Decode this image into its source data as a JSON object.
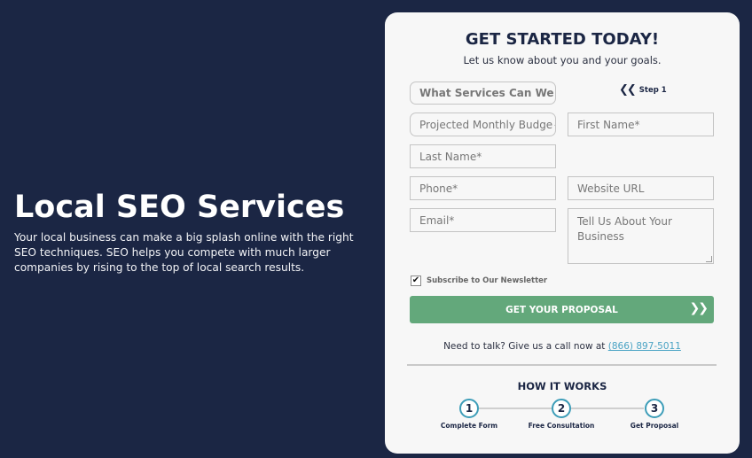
{
  "hero": {
    "title": "Local SEO Services",
    "description": "Your local business can make a big splash online with the right SEO techniques. SEO helps you compete with much larger companies by rising to the top of local search results."
  },
  "form": {
    "title": "GET STARTED TODAY!",
    "subtitle": "Let us know about you and your goals.",
    "step_label": "Step 1",
    "services_select": "What Services Can We",
    "budget_select": "Projected Monthly Budge",
    "first_name_placeholder": "First Name*",
    "last_name_placeholder": "Last Name*",
    "phone_placeholder": "Phone*",
    "website_placeholder": "Website URL",
    "email_placeholder": "Email*",
    "message_placeholder": "Tell Us About Your Business",
    "newsletter_label": "Subscribe to Our Newsletter",
    "newsletter_checked": true,
    "submit_label": "GET YOUR PROPOSAL",
    "call_text": "Need to talk? Give us a call now at",
    "phone_link": "(866) 897-5011"
  },
  "how_it_works": {
    "title": "HOW IT WORKS",
    "steps": [
      {
        "number": "1",
        "label": "Complete Form"
      },
      {
        "number": "2",
        "label": "Free Consultation"
      },
      {
        "number": "3",
        "label": "Get Proposal"
      }
    ]
  },
  "colors": {
    "background": "#1b2644",
    "button": "#63a87b",
    "accent": "#3d9db8"
  }
}
